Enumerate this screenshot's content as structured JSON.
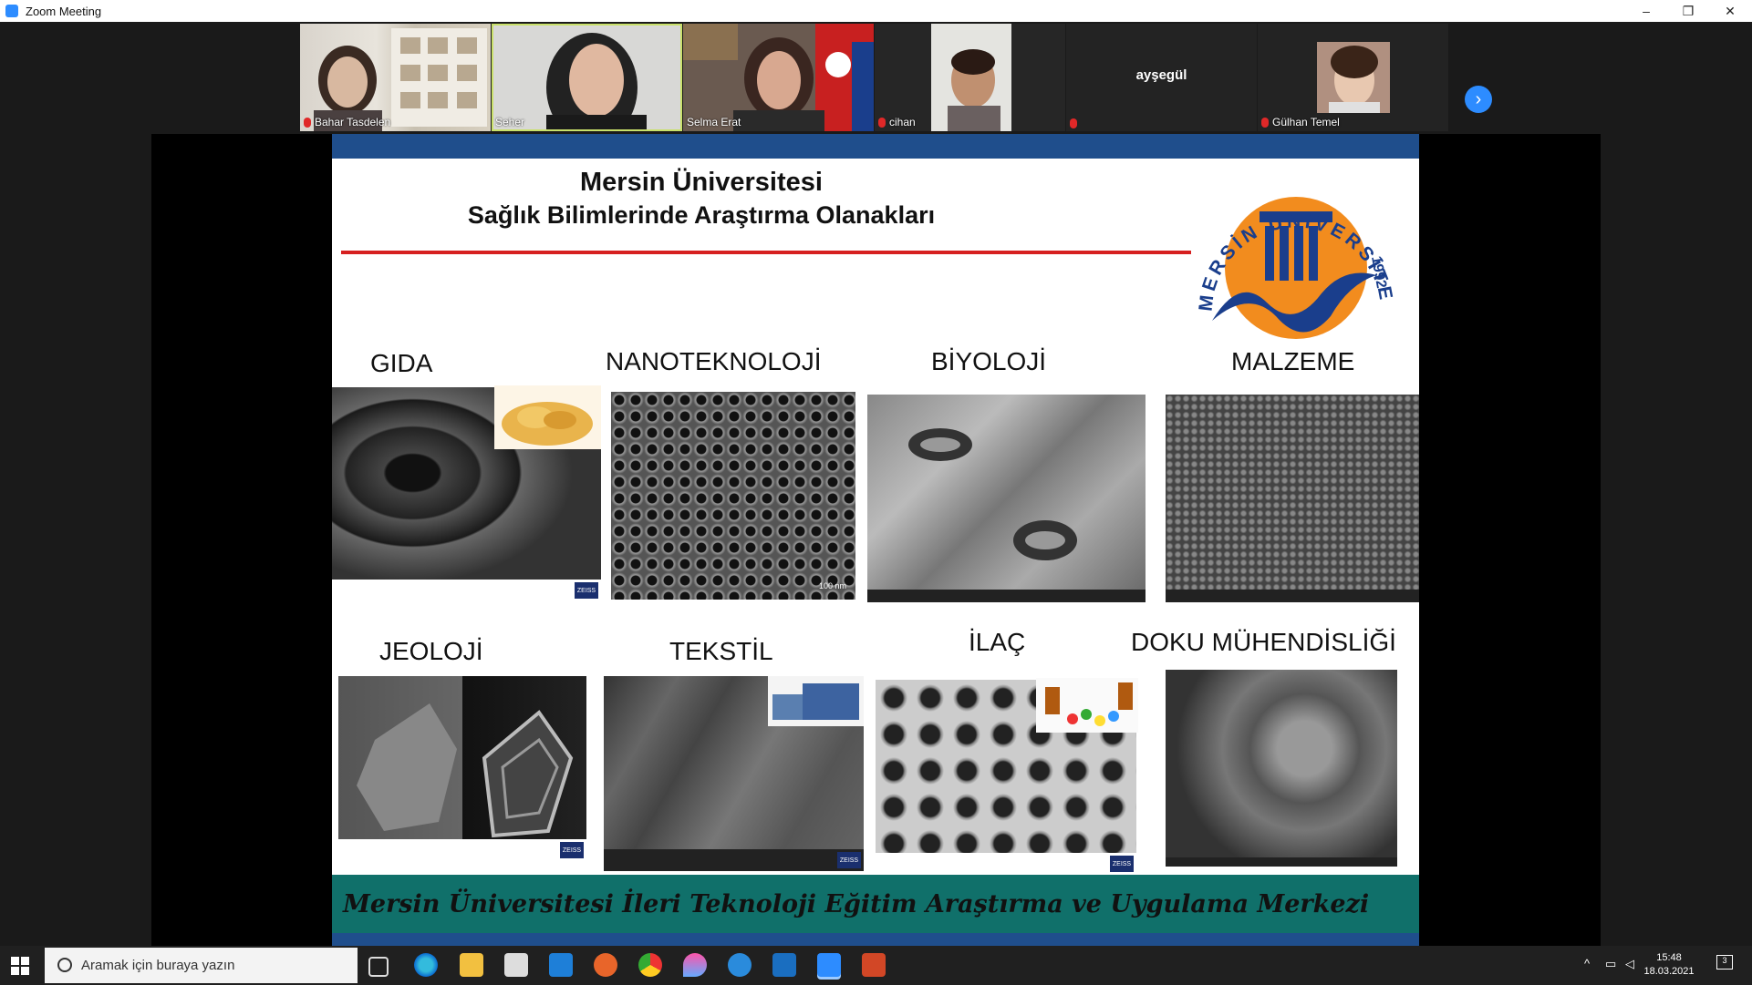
{
  "window": {
    "title": "Zoom Meeting",
    "controls": [
      "–",
      "❐",
      "✕"
    ]
  },
  "participants": [
    {
      "name": "Bahar Tasdelen",
      "muted": true
    },
    {
      "name": "Seher",
      "muted": false,
      "active": true
    },
    {
      "name": "Selma Erat",
      "muted": false
    },
    {
      "name": "cihan",
      "muted": true
    },
    {
      "name": "ayşegül",
      "muted": true,
      "video_off": true
    },
    {
      "name": "Gülhan Temel",
      "muted": true
    }
  ],
  "gallery_next": "›",
  "slide": {
    "title_line1": "Mersin Üniversitesi",
    "title_line2": "Sağlık Bilimlerinde Araştırma Olanakları",
    "logo": {
      "arc_text": "MERSİN ÜNİVERSİTESİ",
      "year": "1992",
      "colors": {
        "sun": "#f28c1e",
        "blue": "#1a3e8c"
      }
    },
    "categories": {
      "gida": "GIDA",
      "nano": "NANOTEKNOLOJİ",
      "biyoloji": "BİYOLOJİ",
      "malzeme": "MALZEME",
      "jeoloji": "JEOLOJİ",
      "tekstil": "TEKSTİL",
      "ilac": "İLAÇ",
      "doku": "DOKU MÜHENDİSLİĞİ"
    },
    "sem_scale_nano": "100 nm",
    "zeiss": "ZEISS",
    "footer": "Mersin Üniversitesi İleri Teknoloji Eğitim Araştırma ve Uygulama Merkezi"
  },
  "taskbar": {
    "search_placeholder": "Aramak için buraya yazın",
    "time": "15:48",
    "date": "18.03.2021",
    "notification_count": "3"
  }
}
